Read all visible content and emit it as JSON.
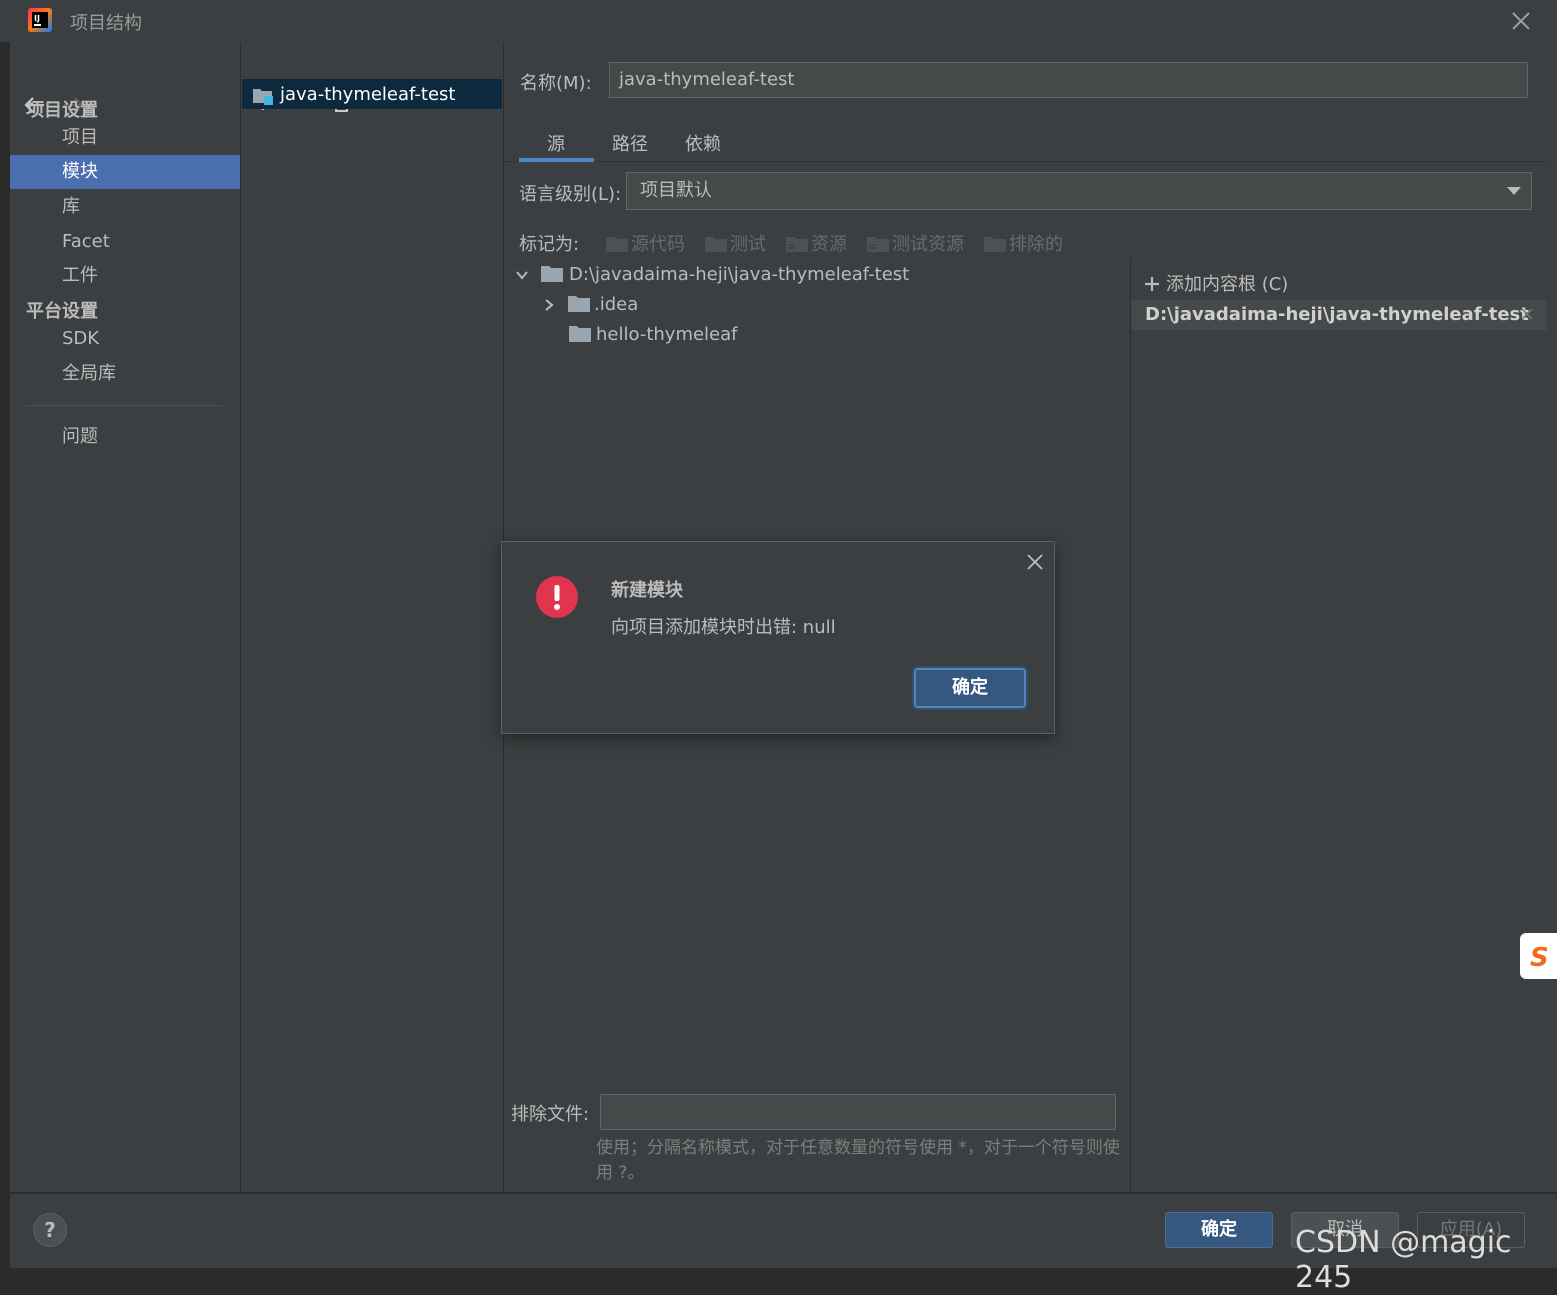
{
  "window": {
    "title": "项目结构"
  },
  "nav": {
    "project_settings_header": "项目设置",
    "platform_settings_header": "平台设置",
    "items": [
      {
        "label": "项目"
      },
      {
        "label": "模块"
      },
      {
        "label": "库"
      },
      {
        "label": "Facet"
      },
      {
        "label": "工件"
      },
      {
        "label": "SDK"
      },
      {
        "label": "全局库"
      },
      {
        "label": "问题"
      }
    ],
    "selected": "模块"
  },
  "modules": {
    "items": [
      "java-thymeleaf-test"
    ]
  },
  "main": {
    "name_label": "名称(M):",
    "name_value": "java-thymeleaf-test",
    "tabs": [
      {
        "label": "源"
      },
      {
        "label": "路径"
      },
      {
        "label": "依赖"
      }
    ],
    "active_tab": "源",
    "language_level_label": "语言级别(L):",
    "language_level_value": "项目默认",
    "mark_as_label": "标记为:",
    "mark_as": [
      "源代码",
      "测试",
      "资源",
      "测试资源",
      "排除的"
    ],
    "tree": [
      {
        "label": "D:\\javadaima-heji\\java-thymeleaf-test",
        "expanded": true
      },
      {
        "label": ".idea",
        "expanded": false
      },
      {
        "label": "hello-thymeleaf"
      }
    ],
    "add_content_root": "添加内容根 (C)",
    "content_root": "D:\\javadaima-heji\\java-thymeleaf-test",
    "exclude_label": "排除文件:",
    "exclude_value": "",
    "exclude_hint": "使用；分隔名称模式，对于任意数量的符号使用 *，对于一个符号则使用 ?。"
  },
  "footer": {
    "help": "?",
    "ok": "确定",
    "cancel": "取消",
    "apply": "应用(A)"
  },
  "dialog": {
    "title": "新建模块",
    "message": "向项目添加模块时出错: null",
    "ok": "确定"
  },
  "watermark": "CSDN @magic 245",
  "colors": {
    "background": "#3c3f41",
    "selection": "#4b6eaf",
    "primary_button": "#365880",
    "error_icon": "#e0344f"
  }
}
